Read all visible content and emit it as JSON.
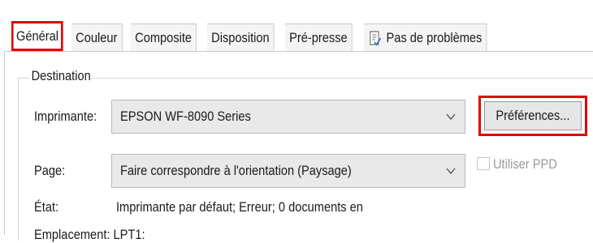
{
  "tabs": [
    {
      "label": "Général",
      "active": true
    },
    {
      "label": "Couleur"
    },
    {
      "label": "Composite"
    },
    {
      "label": "Disposition"
    },
    {
      "label": "Pré-presse"
    },
    {
      "label": "Pas de problèmes",
      "icon": "checklist-icon"
    }
  ],
  "destination": {
    "group_label": "Destination",
    "printer_label": "Imprimante:",
    "printer_value": "EPSON WF-8090 Series",
    "preferences_label": "Préférences...",
    "page_label": "Page:",
    "page_value": "Faire correspondre à l'orientation (Paysage)",
    "use_ppd_label": "Utiliser PPD",
    "use_ppd_checked": false,
    "state_label": "État:",
    "state_value": "Imprimante par défaut; Erreur; 0 documents en",
    "location_partial": "Emplacement:   LPT1:"
  },
  "colors": {
    "highlight": "#e30000"
  }
}
